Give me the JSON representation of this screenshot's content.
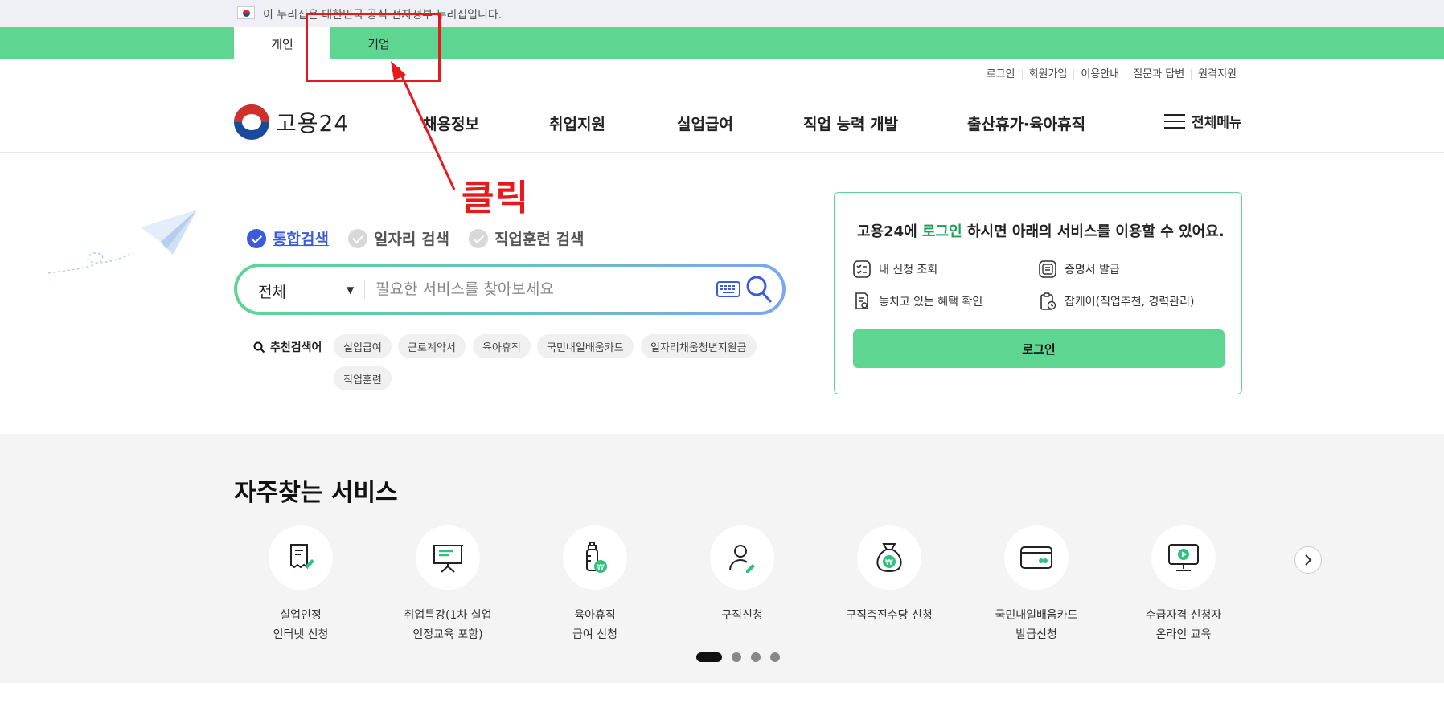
{
  "gov_banner": {
    "text": "이 누리집은 대한민국 공식 전자정부 누리집입니다."
  },
  "tabs": [
    {
      "label": "개인",
      "active": true
    },
    {
      "label": "기업",
      "active": false
    }
  ],
  "util_links": [
    "로그인",
    "회원가입",
    "이용안내",
    "질문과 답변",
    "원격지원"
  ],
  "logo": {
    "text": "고용24"
  },
  "gnb": [
    "채용정보",
    "취업지원",
    "실업급여",
    "직업 능력 개발",
    "출산휴가·육아휴직"
  ],
  "all_menu": {
    "label": "전체메뉴"
  },
  "search_tabs": [
    {
      "label": "통합검색",
      "active": true
    },
    {
      "label": "일자리 검색",
      "active": false
    },
    {
      "label": "직업훈련 검색",
      "active": false
    }
  ],
  "search": {
    "select_value": "전체",
    "placeholder": "필요한 서비스를 찾아보세요"
  },
  "recommended": {
    "label": "추천검색어",
    "chips": [
      "실업급여",
      "근로계약서",
      "육아휴직",
      "국민내일배움카드",
      "일자리채움청년지원금",
      "직업훈련"
    ]
  },
  "login_panel": {
    "title_pre": "고용24에 ",
    "title_highlight": "로그인",
    "title_post": " 하시면 아래의 서비스를 이용할 수 있어요.",
    "services": [
      "내 신청 조회",
      "증명서 발급",
      "놓치고 있는 혜택 확인",
      "잡케어(직업추천, 경력관리)"
    ],
    "button": "로그인"
  },
  "frequent": {
    "title": "자주찾는 서비스",
    "items": [
      {
        "label": "실업인정\n인터넷 신청"
      },
      {
        "label": "취업특강(1차 실업\n인정교육 포함)"
      },
      {
        "label": "육아휴직\n급여 신청"
      },
      {
        "label": "구직신청"
      },
      {
        "label": "구직촉진수당 신청"
      },
      {
        "label": "국민내일배움카드\n발급신청"
      },
      {
        "label": "수급자격 신청자\n온라인 교육"
      }
    ]
  },
  "annotation": {
    "text": "클릭"
  },
  "colors": {
    "green": "#5fd592",
    "blue": "#3b5bdb",
    "red": "#e8191c"
  }
}
